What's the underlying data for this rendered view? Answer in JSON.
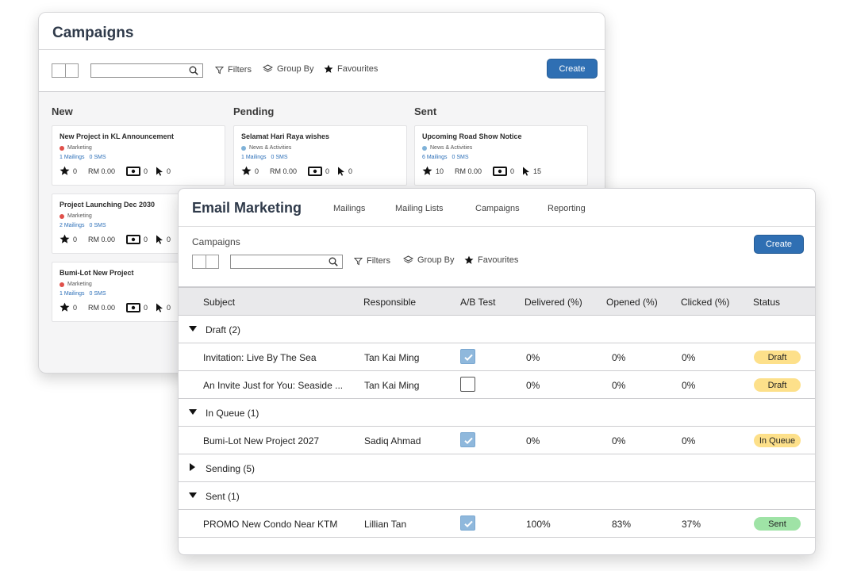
{
  "back": {
    "title": "Campaigns",
    "toolbar": {
      "filters": "Filters",
      "group_by": "Group By",
      "favourites": "Favourites",
      "create": "Create"
    },
    "columns": [
      {
        "title": "New",
        "cards": [
          {
            "title": "New Project in KL Announcement",
            "tag": "Marketing",
            "mailings": "1 Mailings",
            "sms": "0 SMS",
            "stars": "0",
            "rm": "RM 0.00",
            "views": "0",
            "clicks": "0"
          },
          {
            "title": "Project Launching Dec 2030",
            "tag": "Marketing",
            "mailings": "2 Mailings",
            "sms": "0 SMS",
            "stars": "0",
            "rm": "RM 0.00",
            "views": "0",
            "clicks": "0"
          },
          {
            "title": "Bumi-Lot New Project",
            "tag": "Marketing",
            "mailings": "1 Mailings",
            "sms": "0 SMS",
            "stars": "0",
            "rm": "RM 0.00",
            "views": "0",
            "clicks": "0"
          }
        ]
      },
      {
        "title": "Pending",
        "cards": [
          {
            "title": "Selamat Hari Raya wishes",
            "tag": "News & Activities",
            "mailings": "1 Mailings",
            "sms": "0 SMS",
            "stars": "0",
            "rm": "RM 0.00",
            "views": "0",
            "clicks": "0"
          }
        ]
      },
      {
        "title": "Sent",
        "cards": [
          {
            "title": "Upcoming Road Show Notice",
            "tag": "News & Activities",
            "mailings": "6 Mailings",
            "sms": "0 SMS",
            "stars": "10",
            "rm": "RM 0.00",
            "views": "0",
            "clicks": "15"
          }
        ]
      }
    ],
    "colors": {
      "marketing_dot": "#e0504a",
      "news_dot": "#7fb2d8",
      "create": "#2f6fb3"
    }
  },
  "front": {
    "title": "Email Marketing",
    "nav": [
      "Mailings",
      "Mailing Lists",
      "Campaigns",
      "Reporting"
    ],
    "breadcrumb": "Campaigns",
    "toolbar": {
      "filters": "Filters",
      "group_by": "Group By",
      "favourites": "Favourites",
      "create": "Create"
    },
    "columns": [
      "Subject",
      "Responsible",
      "A/B Test",
      "Delivered (%)",
      "Opened (%)",
      "Clicked (%)",
      "Status"
    ],
    "groups": [
      {
        "label": "Draft (2)",
        "expanded": true,
        "rows": [
          {
            "subject": "Invitation: Live By The Sea",
            "responsible": "Tan Kai Ming",
            "ab": true,
            "delivered": "0%",
            "opened": "0%",
            "clicked": "0%",
            "status": "Draft"
          },
          {
            "subject": "An Invite Just for You: Seaside ...",
            "responsible": "Tan Kai Ming",
            "ab": false,
            "delivered": "0%",
            "opened": "0%",
            "clicked": "0%",
            "status": "Draft"
          }
        ]
      },
      {
        "label": "In Queue (1)",
        "expanded": true,
        "rows": [
          {
            "subject": "Bumi-Lot New Project 2027",
            "responsible": "Sadiq Ahmad",
            "ab": true,
            "delivered": "0%",
            "opened": "0%",
            "clicked": "0%",
            "status": "In Queue"
          }
        ]
      },
      {
        "label": "Sending (5)",
        "expanded": false,
        "rows": []
      },
      {
        "label": "Sent (1)",
        "expanded": true,
        "rows": [
          {
            "subject": "PROMO New Condo Near KTM",
            "responsible": "Lillian Tan",
            "ab": true,
            "delivered": "100%",
            "opened": "83%",
            "clicked": "37%",
            "status": "Sent"
          }
        ]
      }
    ],
    "colors": {
      "draft": "#fde08a",
      "in_queue": "#fde08a",
      "sent": "#9fe3a6",
      "checkbox_on": "#8fb8dc"
    }
  }
}
